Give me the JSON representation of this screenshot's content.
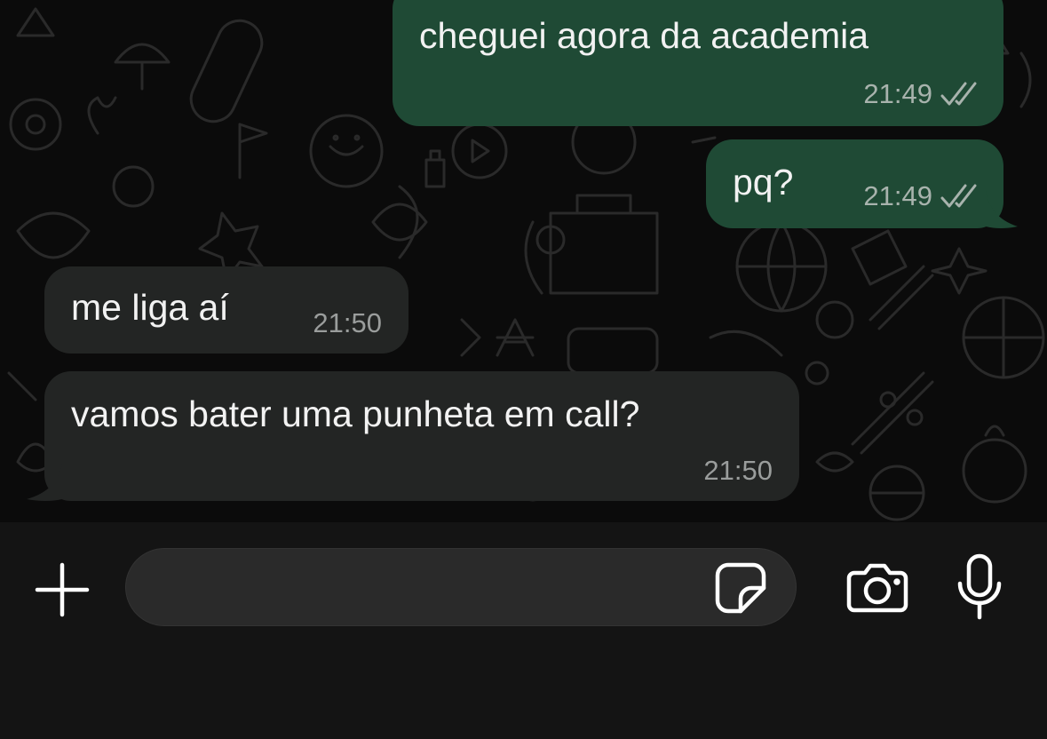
{
  "chat": {
    "messages": [
      {
        "direction": "out",
        "text": "cheguei agora da academia",
        "time": "21:49",
        "status": "read"
      },
      {
        "direction": "out",
        "text": "pq?",
        "time": "21:49",
        "status": "read"
      },
      {
        "direction": "in",
        "text": "me liga aí",
        "time": "21:50"
      },
      {
        "direction": "in",
        "text": "vamos bater uma punheta em call?",
        "time": "21:50"
      }
    ]
  },
  "input_bar": {
    "field_value": "",
    "icons": {
      "plus": "plus-icon",
      "sticker": "sticker-icon",
      "camera": "camera-icon",
      "mic": "microphone-icon"
    }
  },
  "colors": {
    "outgoing_bubble": "#1f4a35",
    "incoming_bubble": "#232524",
    "background": "#0b0b0b",
    "input_bar": "#141414",
    "read_ticks": "#a8b3ad"
  }
}
